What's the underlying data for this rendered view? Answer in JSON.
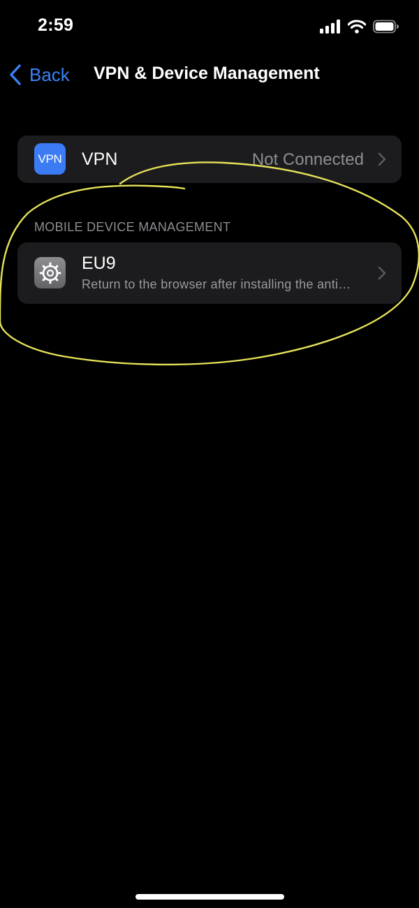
{
  "status_bar": {
    "time": "2:59",
    "icons": [
      "signal-icon",
      "wifi-icon",
      "battery-icon"
    ]
  },
  "nav": {
    "back_label": "Back",
    "title": "VPN & Device Management"
  },
  "vpn": {
    "icon_text": "VPN",
    "label": "VPN",
    "status": "Not Connected"
  },
  "mdm": {
    "section_header": "MOBILE DEVICE MANAGEMENT",
    "profile": {
      "name": "EU9",
      "description": "Return to the browser after installing the anti…",
      "icon": "settings-gear-icon"
    }
  },
  "colors": {
    "accent": "#3a82f7",
    "background": "#000000",
    "cell": "#1c1c1e",
    "secondary_text": "#8e8e93",
    "annotation": "#e6e25a"
  }
}
